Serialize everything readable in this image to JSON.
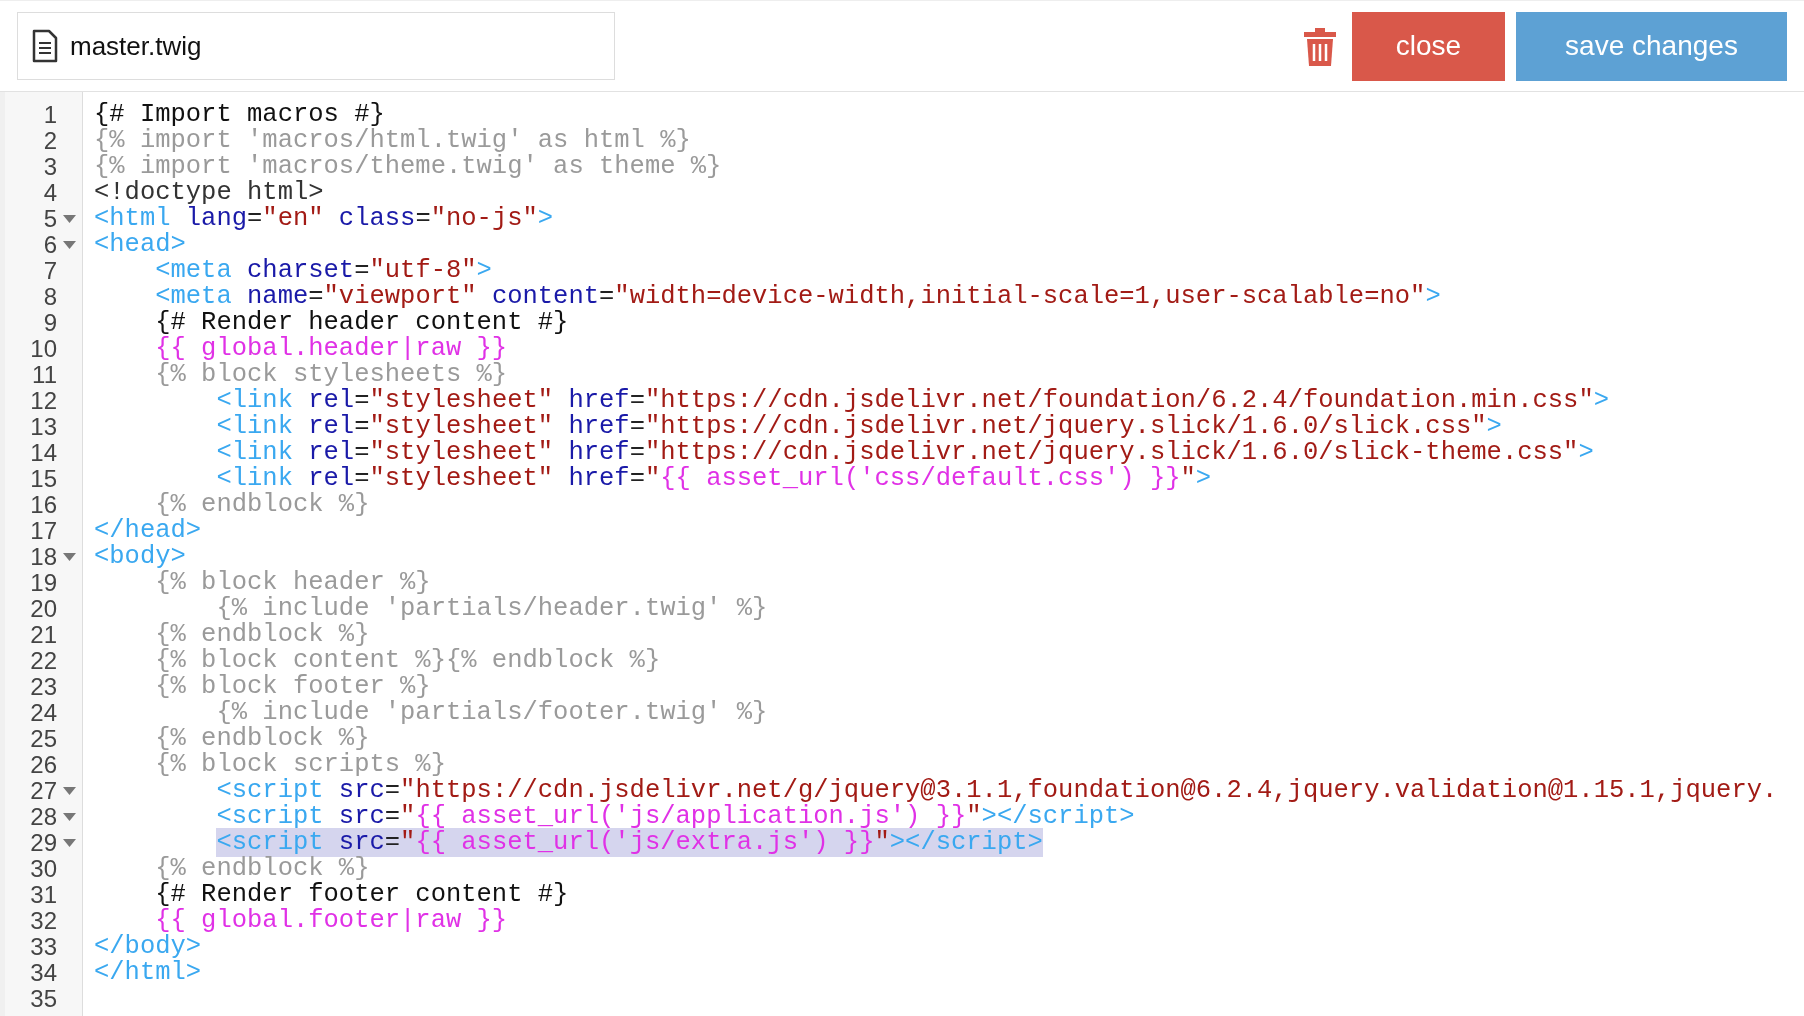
{
  "file": {
    "name": "master.twig"
  },
  "buttons": {
    "close": "close",
    "save": "save changes"
  },
  "editor": {
    "lines": [
      {
        "number": "1",
        "foldable": false,
        "selected": false,
        "tokens": [
          {
            "kind": "comment",
            "text": "{# Import macros #}"
          }
        ]
      },
      {
        "number": "2",
        "foldable": false,
        "selected": false,
        "tokens": [
          {
            "kind": "twig",
            "text": "{% import 'macros/html.twig' as html %}"
          }
        ]
      },
      {
        "number": "3",
        "foldable": false,
        "selected": false,
        "tokens": [
          {
            "kind": "twig",
            "text": "{% import 'macros/theme.twig' as theme %}"
          }
        ]
      },
      {
        "number": "4",
        "foldable": false,
        "selected": false,
        "tokens": [
          {
            "kind": "doctype",
            "text": "<!doctype html>"
          }
        ]
      },
      {
        "number": "5",
        "foldable": true,
        "selected": false,
        "tokens": [
          {
            "kind": "tag",
            "text": "<html"
          },
          {
            "kind": "attr",
            "text": " lang"
          },
          {
            "kind": "eq",
            "text": "="
          },
          {
            "kind": "string",
            "text": "\"en\""
          },
          {
            "kind": "attr",
            "text": " class"
          },
          {
            "kind": "eq",
            "text": "="
          },
          {
            "kind": "string",
            "text": "\"no-js\""
          },
          {
            "kind": "tag",
            "text": ">"
          }
        ]
      },
      {
        "number": "6",
        "foldable": true,
        "selected": false,
        "tokens": [
          {
            "kind": "tag",
            "text": "<head>"
          }
        ]
      },
      {
        "number": "7",
        "foldable": false,
        "selected": false,
        "tokens": [
          {
            "kind": "tag",
            "text": "    <meta"
          },
          {
            "kind": "attr",
            "text": " charset"
          },
          {
            "kind": "eq",
            "text": "="
          },
          {
            "kind": "string",
            "text": "\"utf-8\""
          },
          {
            "kind": "tag",
            "text": ">"
          }
        ]
      },
      {
        "number": "8",
        "foldable": false,
        "selected": false,
        "tokens": [
          {
            "kind": "tag",
            "text": "    <meta"
          },
          {
            "kind": "attr",
            "text": " name"
          },
          {
            "kind": "eq",
            "text": "="
          },
          {
            "kind": "string",
            "text": "\"viewport\""
          },
          {
            "kind": "attr",
            "text": " content"
          },
          {
            "kind": "eq",
            "text": "="
          },
          {
            "kind": "string",
            "text": "\"width=device-width,initial-scale=1,user-scalable=no\""
          },
          {
            "kind": "tag",
            "text": ">"
          }
        ]
      },
      {
        "number": "9",
        "foldable": false,
        "selected": false,
        "tokens": [
          {
            "kind": "comment",
            "text": "    {# Render header content #}"
          }
        ]
      },
      {
        "number": "10",
        "foldable": false,
        "selected": false,
        "tokens": [
          {
            "kind": "expr",
            "text": "    {{ global.header|raw }}"
          }
        ]
      },
      {
        "number": "11",
        "foldable": false,
        "selected": false,
        "tokens": [
          {
            "kind": "twig",
            "text": "    {% block stylesheets %}"
          }
        ]
      },
      {
        "number": "12",
        "foldable": false,
        "selected": false,
        "tokens": [
          {
            "kind": "tag",
            "text": "        <link"
          },
          {
            "kind": "attr",
            "text": " rel"
          },
          {
            "kind": "eq",
            "text": "="
          },
          {
            "kind": "string",
            "text": "\"stylesheet\""
          },
          {
            "kind": "attr",
            "text": " href"
          },
          {
            "kind": "eq",
            "text": "="
          },
          {
            "kind": "string",
            "text": "\"https://cdn.jsdelivr.net/foundation/6.2.4/foundation.min.css\""
          },
          {
            "kind": "tag",
            "text": ">"
          }
        ]
      },
      {
        "number": "13",
        "foldable": false,
        "selected": false,
        "tokens": [
          {
            "kind": "tag",
            "text": "        <link"
          },
          {
            "kind": "attr",
            "text": " rel"
          },
          {
            "kind": "eq",
            "text": "="
          },
          {
            "kind": "string",
            "text": "\"stylesheet\""
          },
          {
            "kind": "attr",
            "text": " href"
          },
          {
            "kind": "eq",
            "text": "="
          },
          {
            "kind": "string",
            "text": "\"https://cdn.jsdelivr.net/jquery.slick/1.6.0/slick.css\""
          },
          {
            "kind": "tag",
            "text": ">"
          }
        ]
      },
      {
        "number": "14",
        "foldable": false,
        "selected": false,
        "tokens": [
          {
            "kind": "tag",
            "text": "        <link"
          },
          {
            "kind": "attr",
            "text": " rel"
          },
          {
            "kind": "eq",
            "text": "="
          },
          {
            "kind": "string",
            "text": "\"stylesheet\""
          },
          {
            "kind": "attr",
            "text": " href"
          },
          {
            "kind": "eq",
            "text": "="
          },
          {
            "kind": "string",
            "text": "\"https://cdn.jsdelivr.net/jquery.slick/1.6.0/slick-theme.css\""
          },
          {
            "kind": "tag",
            "text": ">"
          }
        ]
      },
      {
        "number": "15",
        "foldable": false,
        "selected": false,
        "tokens": [
          {
            "kind": "tag",
            "text": "        <link"
          },
          {
            "kind": "attr",
            "text": " rel"
          },
          {
            "kind": "eq",
            "text": "="
          },
          {
            "kind": "string",
            "text": "\"stylesheet\""
          },
          {
            "kind": "attr",
            "text": " href"
          },
          {
            "kind": "eq",
            "text": "="
          },
          {
            "kind": "string",
            "text": "\""
          },
          {
            "kind": "expr",
            "text": "{{ asset_url('css/default.css') }}"
          },
          {
            "kind": "string",
            "text": "\""
          },
          {
            "kind": "tag",
            "text": ">"
          }
        ]
      },
      {
        "number": "16",
        "foldable": false,
        "selected": false,
        "tokens": [
          {
            "kind": "twig",
            "text": "    {% endblock %}"
          }
        ]
      },
      {
        "number": "17",
        "foldable": false,
        "selected": false,
        "tokens": [
          {
            "kind": "tag",
            "text": "</head>"
          }
        ]
      },
      {
        "number": "18",
        "foldable": true,
        "selected": false,
        "tokens": [
          {
            "kind": "tag",
            "text": "<body>"
          }
        ]
      },
      {
        "number": "19",
        "foldable": false,
        "selected": false,
        "tokens": [
          {
            "kind": "twig",
            "text": "    {% block header %}"
          }
        ]
      },
      {
        "number": "20",
        "foldable": false,
        "selected": false,
        "tokens": [
          {
            "kind": "twig",
            "text": "        {% include 'partials/header.twig' %}"
          }
        ]
      },
      {
        "number": "21",
        "foldable": false,
        "selected": false,
        "tokens": [
          {
            "kind": "twig",
            "text": "    {% endblock %}"
          }
        ]
      },
      {
        "number": "22",
        "foldable": false,
        "selected": false,
        "tokens": [
          {
            "kind": "twig",
            "text": "    {% block content %}{% endblock %}"
          }
        ]
      },
      {
        "number": "23",
        "foldable": false,
        "selected": false,
        "tokens": [
          {
            "kind": "twig",
            "text": "    {% block footer %}"
          }
        ]
      },
      {
        "number": "24",
        "foldable": false,
        "selected": false,
        "tokens": [
          {
            "kind": "twig",
            "text": "        {% include 'partials/footer.twig' %}"
          }
        ]
      },
      {
        "number": "25",
        "foldable": false,
        "selected": false,
        "tokens": [
          {
            "kind": "twig",
            "text": "    {% endblock %}"
          }
        ]
      },
      {
        "number": "26",
        "foldable": false,
        "selected": false,
        "tokens": [
          {
            "kind": "twig",
            "text": "    {% block scripts %}"
          }
        ]
      },
      {
        "number": "27",
        "foldable": true,
        "selected": false,
        "tokens": [
          {
            "kind": "tag",
            "text": "        <script"
          },
          {
            "kind": "attr",
            "text": " src"
          },
          {
            "kind": "eq",
            "text": "="
          },
          {
            "kind": "string",
            "text": "\"https://cdn.jsdelivr.net/g/jquery@3.1.1,foundation@6.2.4,jquery.validation@1.15.1,jquery."
          }
        ]
      },
      {
        "number": "28",
        "foldable": true,
        "selected": false,
        "tokens": [
          {
            "kind": "tag",
            "text": "        <script"
          },
          {
            "kind": "attr",
            "text": " src"
          },
          {
            "kind": "eq",
            "text": "="
          },
          {
            "kind": "string",
            "text": "\""
          },
          {
            "kind": "expr",
            "text": "{{ asset_url('js/application.js') }}"
          },
          {
            "kind": "string",
            "text": "\""
          },
          {
            "kind": "tag",
            "text": "></script>"
          }
        ]
      },
      {
        "number": "29",
        "foldable": true,
        "selected": true,
        "tokens": [
          {
            "kind": "tag",
            "text": "        <script"
          },
          {
            "kind": "attr",
            "text": " src"
          },
          {
            "kind": "eq",
            "text": "="
          },
          {
            "kind": "string",
            "text": "\""
          },
          {
            "kind": "expr",
            "text": "{{ asset_url('js/extra.js') }}"
          },
          {
            "kind": "string",
            "text": "\""
          },
          {
            "kind": "tag",
            "text": "></script>"
          }
        ]
      },
      {
        "number": "30",
        "foldable": false,
        "selected": false,
        "tokens": [
          {
            "kind": "twig",
            "text": "    {% endblock %}"
          }
        ]
      },
      {
        "number": "31",
        "foldable": false,
        "selected": false,
        "tokens": [
          {
            "kind": "comment",
            "text": "    {# Render footer content #}"
          }
        ]
      },
      {
        "number": "32",
        "foldable": false,
        "selected": false,
        "tokens": [
          {
            "kind": "expr",
            "text": "    {{ global.footer|raw }}"
          }
        ]
      },
      {
        "number": "33",
        "foldable": false,
        "selected": false,
        "tokens": [
          {
            "kind": "tag",
            "text": "</body>"
          }
        ]
      },
      {
        "number": "34",
        "foldable": false,
        "selected": false,
        "tokens": [
          {
            "kind": "tag",
            "text": "</html>"
          }
        ]
      },
      {
        "number": "35",
        "foldable": false,
        "selected": false
      }
    ]
  }
}
